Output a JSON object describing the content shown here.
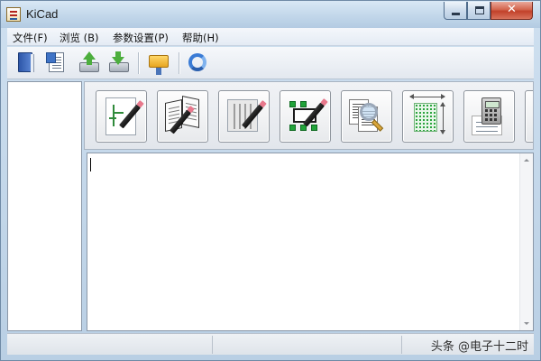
{
  "window": {
    "title": "KiCad"
  },
  "menu": {
    "items": [
      {
        "label": "文件(F)"
      },
      {
        "label": "浏览 (B)"
      },
      {
        "label": "参数设置(P)"
      },
      {
        "label": "帮助(H)"
      }
    ]
  },
  "toolbar": {
    "buttons": [
      {
        "icon": "new-project-icon"
      },
      {
        "icon": "new-from-template-icon"
      },
      {
        "icon": "open-project-icon"
      },
      {
        "icon": "save-project-icon"
      },
      {
        "icon": "archive-folder-icon"
      },
      {
        "icon": "refresh-icon"
      }
    ]
  },
  "launcher": {
    "tools": [
      {
        "icon": "schematic-editor-icon"
      },
      {
        "icon": "symbol-library-editor-icon"
      },
      {
        "icon": "pcb-editor-icon"
      },
      {
        "icon": "footprint-editor-icon"
      },
      {
        "icon": "gerber-viewer-icon"
      },
      {
        "icon": "bitmap-to-component-icon"
      },
      {
        "icon": "pcb-calculator-icon"
      }
    ]
  },
  "log": {
    "text": ""
  },
  "status": {
    "watermark": "头条 @电子十二时"
  },
  "colors": {
    "titlebar": "#c2d7ea",
    "close_button": "#c2412a",
    "panel_border": "#8b98a8"
  }
}
